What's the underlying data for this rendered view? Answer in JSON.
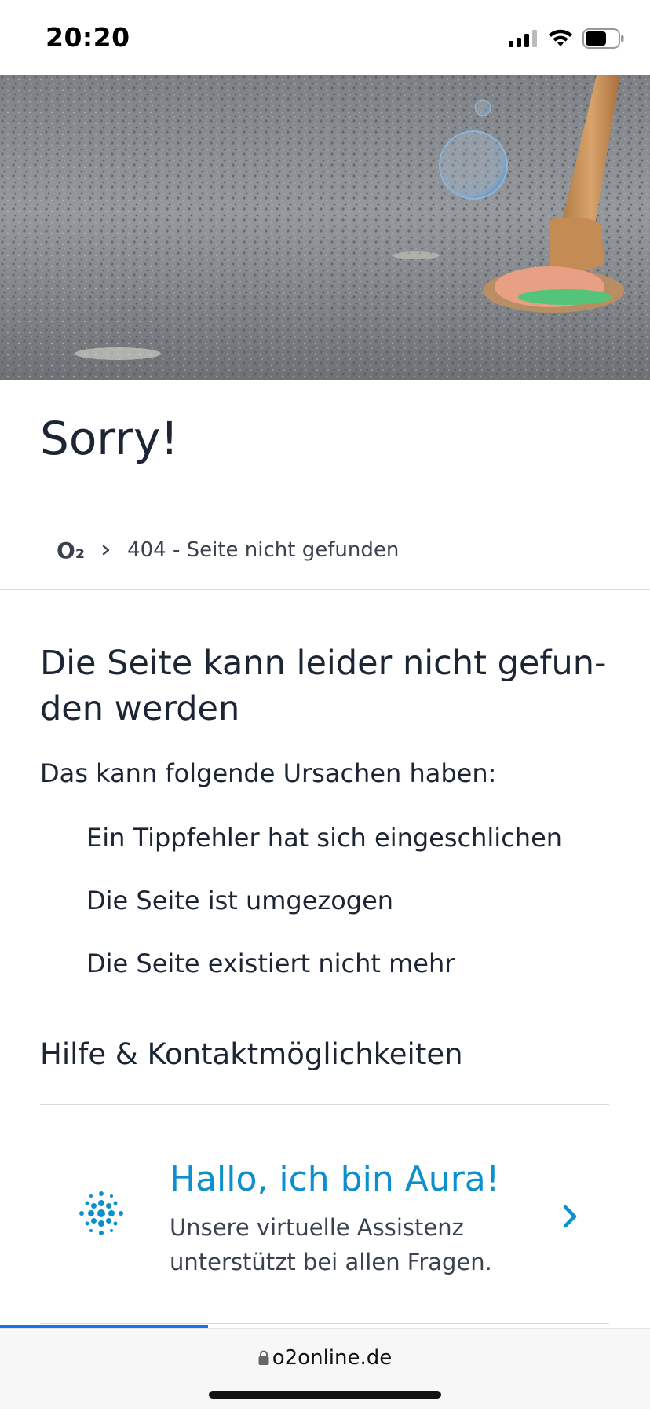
{
  "status_bar": {
    "time": "20:20",
    "icons": [
      "signal-icon",
      "wifi-icon",
      "battery-icon"
    ]
  },
  "hero": {
    "image": "melted-ice-cream-cone-on-asphalt"
  },
  "page": {
    "title": "Sorry!"
  },
  "breadcrumb": {
    "home_label": "O₂",
    "current": "404 - Seite nicht gefunden"
  },
  "content": {
    "heading": "Die Seite kann leider nicht gefun-den werden",
    "intro": "Das kann folgende Ursachen haben:",
    "reasons": [
      "Ein Tippfehler hat sich eingeschlichen",
      "Die Seite ist umgezogen",
      "Die Seite existiert nicht mehr"
    ]
  },
  "help": {
    "heading": "Hilfe & Kontaktmöglichkeiten",
    "aura": {
      "title": "Hallo, ich bin Aura!",
      "text": "Unsere virtuelle Assistenz unterstützt bei allen Fragen.",
      "icon": "aura-assistant-icon"
    }
  },
  "browser": {
    "url": "o2online.de",
    "loading_progress": 0.32
  },
  "colors": {
    "text": "#1c2533",
    "accent": "#0d8fce",
    "progress": "#1a73e8"
  }
}
